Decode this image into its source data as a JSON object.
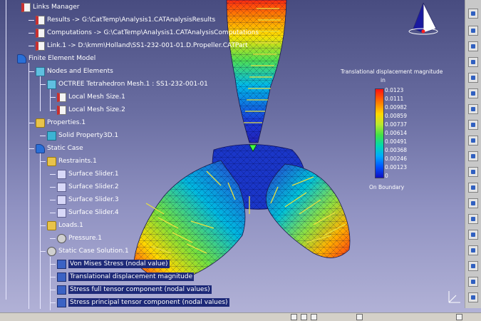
{
  "tree": {
    "links_manager": "Links Manager",
    "link_results": "Results -> G:\\CatTemp\\Analysis1.CATAnalysisResults",
    "link_computations": "Computations -> G:\\CatTemp\\Analysis1.CATAnalysisComputations",
    "link_part": "Link.1 -> D:\\kmm\\Holland\\SS1-232-001-01.D.Propeller.CATPart",
    "fem": "Finite Element Model",
    "nodes_elements": "Nodes and Elements",
    "octree_mesh": "OCTREE Tetrahedron Mesh.1 : SS1-232-001-01",
    "local_mesh_1": "Local Mesh Size.1",
    "local_mesh_2": "Local Mesh Size.2",
    "properties": "Properties.1",
    "solid_property": "Solid Property3D.1",
    "static_case": "Static Case",
    "restraints": "Restraints.1",
    "slider_1": "Surface Slider.1",
    "slider_2": "Surface Slider.2",
    "slider_3": "Surface Slider.3",
    "slider_4": "Surface Slider.4",
    "loads": "Loads.1",
    "pressure": "Pressure.1",
    "solution": "Static Case Solution.1",
    "von_mises": "Von Mises Stress (nodal value)",
    "translational": "Translational displacement magnitude",
    "stress_full": "Stress full tensor component (nodal values)",
    "stress_principal": "Stress principal tensor component (nodal values)"
  },
  "legend": {
    "title": "Translational displacement magnitude",
    "unit": "in",
    "values": [
      "0.0123",
      "0.0111",
      "0.00982",
      "0.00859",
      "0.00737",
      "0.00614",
      "0.00491",
      "0.00368",
      "0.00246",
      "0.00123",
      "0"
    ],
    "on_boundary": "On Boundary"
  },
  "colors": {
    "background_top": "#484c80",
    "background_bottom": "#b4b4d8",
    "scale_max": "#ff1010",
    "scale_min": "#1010c0"
  },
  "icons": [
    "compass-icon",
    "axis-icon",
    "toolbar-icons",
    "status-icons"
  ]
}
